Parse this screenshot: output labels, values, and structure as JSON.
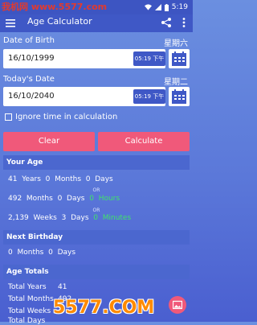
{
  "status_bar": {
    "watermark": "我机网 www.5577.com",
    "time": "5:19"
  },
  "toolbar": {
    "title": "Age Calculator"
  },
  "date_of_birth": {
    "label": "Date of Birth",
    "weekday": "星期六",
    "date": "16/10/1999",
    "time": "05:19 下午"
  },
  "todays_date": {
    "label": "Today's Date",
    "weekday": "星期二",
    "date": "16/10/2040",
    "time": "05:19 下午"
  },
  "ignore_time": {
    "label": "Ignore time in calculation",
    "checked": false
  },
  "buttons": {
    "clear": "Clear",
    "calculate": "Calculate"
  },
  "your_age": {
    "title": "Your Age",
    "line1": {
      "years": "41",
      "years_label": "Years",
      "months": "0",
      "months_label": "Months",
      "days": "0",
      "days_label": "Days"
    },
    "or1": "OR",
    "line2": {
      "months": "492",
      "months_label": "Months",
      "days": "0",
      "days_label": "Days",
      "hours": "0",
      "hours_label": "Hours"
    },
    "or2": "OR",
    "line3": {
      "days_count": "2,139",
      "weeks_label": "Weeks",
      "weeks": "3",
      "days_label": "Days",
      "minutes": "0",
      "minutes_label": "Minutes"
    }
  },
  "next_birthday": {
    "title": "Next Birthday",
    "months": "0",
    "months_label": "Months",
    "days": "0",
    "days_label": "Days"
  },
  "age_totals": {
    "title": "Age Totals",
    "rows": [
      {
        "label": "Total Years",
        "value": "41"
      },
      {
        "label": "Total Months",
        "value": "492"
      },
      {
        "label": "Total Weeks",
        "value": ""
      },
      {
        "label": "Total Days",
        "value": ""
      }
    ]
  },
  "badge": "5577.COM",
  "colors": {
    "accent": "#f0597a",
    "primary": "#3f58c6",
    "green": "#3fe36a"
  }
}
